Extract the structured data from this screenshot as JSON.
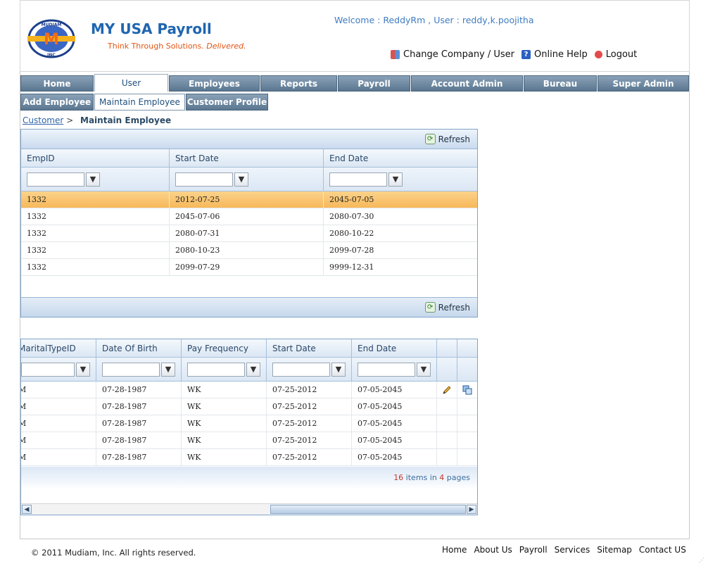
{
  "header": {
    "brand": "MY USA Payroll",
    "tagline_plain": "Think Through Solutions. ",
    "tagline_em": "Delivered.",
    "logo_arc_text": "MUDIAM",
    "logo_letter": "M",
    "logo_sub": "INC",
    "welcome": "Welcome : ReddyRm , User : reddy,k.poojitha",
    "links": {
      "change": "Change Company / User",
      "help": "Online Help",
      "logout": "Logout"
    }
  },
  "nav": {
    "tabs": [
      "Home",
      "User",
      "Employees",
      "Reports",
      "Payroll",
      "Account Admin",
      "Bureau",
      "Super Admin"
    ],
    "active": "User"
  },
  "subnav": {
    "tabs": [
      "Add Employee",
      "Maintain Employee",
      "Customer Profile"
    ],
    "active": "Maintain Employee"
  },
  "breadcrumb": {
    "link": "Customer",
    "sep": ">",
    "current": "Maintain Employee"
  },
  "grid1": {
    "refresh_label": "Refresh",
    "columns": [
      "EmpID",
      "Start Date",
      "End Date"
    ],
    "rows": [
      [
        "1332",
        "2012-07-25",
        "2045-07-05"
      ],
      [
        "1332",
        "2045-07-06",
        "2080-07-30"
      ],
      [
        "1332",
        "2080-07-31",
        "2080-10-22"
      ],
      [
        "1332",
        "2080-10-23",
        "2099-07-28"
      ],
      [
        "1332",
        "2099-07-29",
        "9999-12-31"
      ]
    ]
  },
  "grid2": {
    "columns": [
      "MaritalTypeID",
      "Date Of Birth",
      "Pay Frequency",
      "Start Date",
      "End Date"
    ],
    "rows": [
      [
        "M",
        "07-28-1987",
        "WK",
        "07-25-2012",
        "07-05-2045"
      ],
      [
        "M",
        "07-28-1987",
        "WK",
        "07-25-2012",
        "07-05-2045"
      ],
      [
        "M",
        "07-28-1987",
        "WK",
        "07-25-2012",
        "07-05-2045"
      ],
      [
        "M",
        "07-28-1987",
        "WK",
        "07-25-2012",
        "07-05-2045"
      ],
      [
        "M",
        "07-28-1987",
        "WK",
        "07-25-2012",
        "07-05-2045"
      ]
    ],
    "pager": {
      "total": "16",
      "mid": " items in ",
      "pages": "4",
      "end": " pages"
    }
  },
  "footer": {
    "copyright": "© 2011 Mudiam, Inc. All rights reserved.",
    "links": [
      "Home",
      "About Us",
      "Payroll",
      "Services",
      "Sitemap",
      "Contact US"
    ]
  },
  "colors": {
    "brand": "#1f66b0",
    "tagline": "#e25513",
    "selected_row": "#f7b85a",
    "nav": "#5a7690"
  }
}
